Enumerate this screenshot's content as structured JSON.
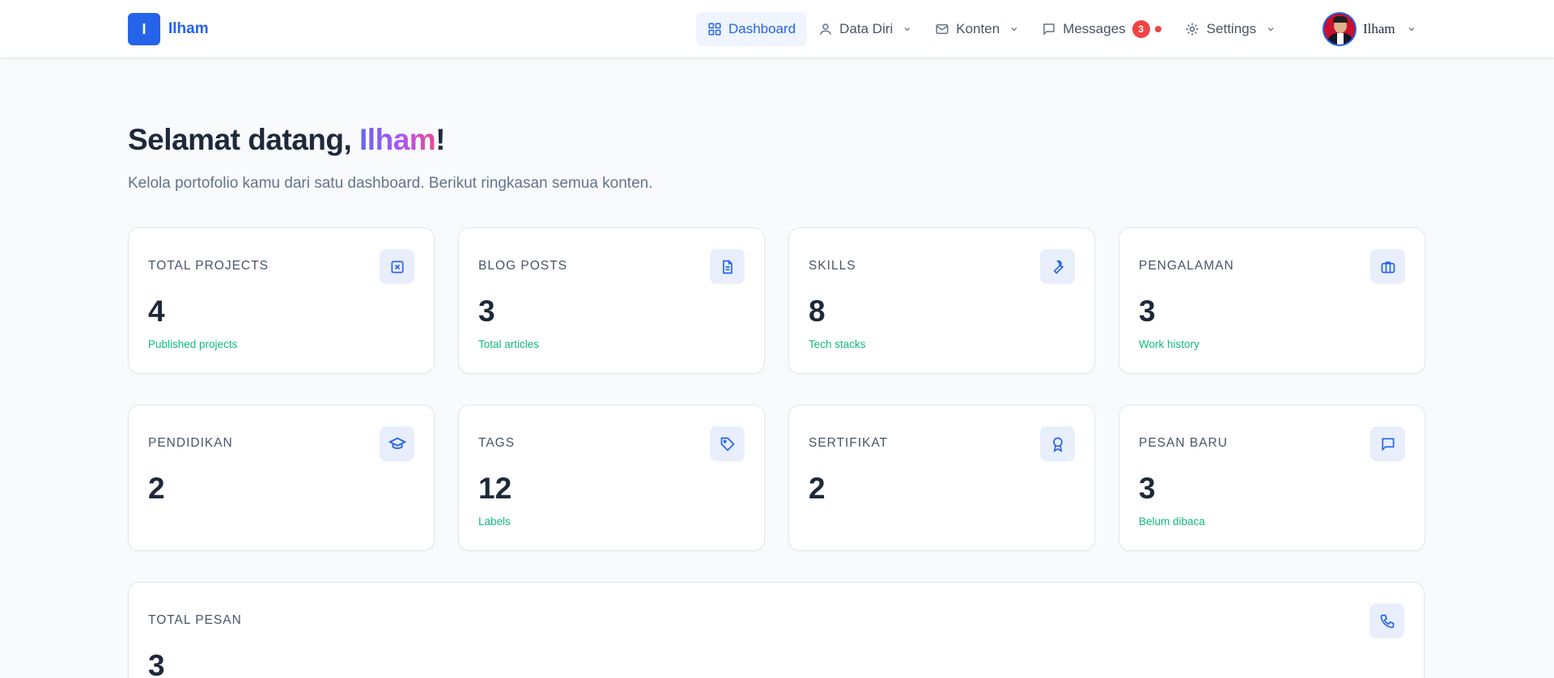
{
  "brand": {
    "logo_letter": "I",
    "name": "Ilham"
  },
  "nav": {
    "dashboard": "Dashboard",
    "data_diri": "Data Diri",
    "konten": "Konten",
    "messages": "Messages",
    "messages_count": "3",
    "settings": "Settings"
  },
  "user": {
    "name": "Ilham"
  },
  "hero": {
    "title_prefix": "Selamat datang, ",
    "title_name": "Ilham",
    "title_suffix": "!",
    "subtitle": "Kelola portofolio kamu dari satu dashboard. Berikut ringkasan semua konten."
  },
  "cards": [
    {
      "label": "TOTAL PROJECTS",
      "value": "4",
      "note": "Published projects",
      "icon": "project-icon"
    },
    {
      "label": "BLOG POSTS",
      "value": "3",
      "note": "Total articles",
      "icon": "document-icon"
    },
    {
      "label": "SKILLS",
      "value": "8",
      "note": "Tech stacks",
      "icon": "wrench-icon"
    },
    {
      "label": "PENGALAMAN",
      "value": "3",
      "note": "Work history",
      "icon": "briefcase-icon"
    },
    {
      "label": "PENDIDIKAN",
      "value": "2",
      "note": "",
      "icon": "graduation-cap-icon"
    },
    {
      "label": "TAGS",
      "value": "12",
      "note": "Labels",
      "icon": "tag-icon"
    },
    {
      "label": "SERTIFIKAT",
      "value": "2",
      "note": "",
      "icon": "award-icon"
    },
    {
      "label": "PESAN BARU",
      "value": "3",
      "note": "Belum dibaca",
      "icon": "message-icon"
    },
    {
      "label": "TOTAL PESAN",
      "value": "3",
      "note": "",
      "icon": "phone-icon"
    }
  ],
  "colors": {
    "accent": "#2563eb",
    "note": "#10b981",
    "badge": "#ef4444"
  }
}
